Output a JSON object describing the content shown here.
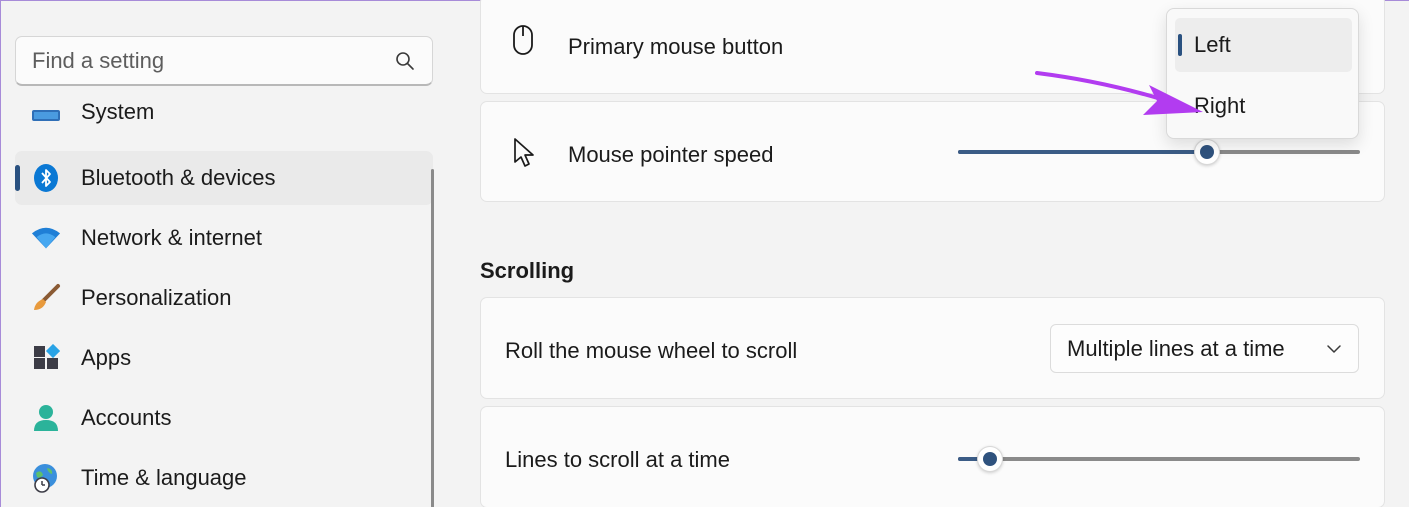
{
  "search": {
    "placeholder": "Find a setting",
    "icon": "search-icon"
  },
  "sidebar": {
    "items": [
      {
        "label": "System",
        "icon": "monitor-icon",
        "active": false
      },
      {
        "label": "Bluetooth & devices",
        "icon": "bluetooth-icon",
        "active": true
      },
      {
        "label": "Network & internet",
        "icon": "wifi-icon",
        "active": false
      },
      {
        "label": "Personalization",
        "icon": "paintbrush-icon",
        "active": false
      },
      {
        "label": "Apps",
        "icon": "apps-icon",
        "active": false
      },
      {
        "label": "Accounts",
        "icon": "person-icon",
        "active": false
      },
      {
        "label": "Time & language",
        "icon": "globe-clock-icon",
        "active": false
      }
    ]
  },
  "mouse": {
    "primary_button": {
      "label": "Primary mouse button",
      "icon": "mouse-icon"
    },
    "pointer_speed": {
      "label": "Mouse pointer speed",
      "icon": "cursor-icon",
      "value_fraction": 0.62
    }
  },
  "primary_button_menu": {
    "options": [
      {
        "label": "Left",
        "selected": true
      },
      {
        "label": "Right",
        "selected": false
      }
    ]
  },
  "scrolling": {
    "title": "Scrolling",
    "wheel": {
      "label": "Roll the mouse wheel to scroll",
      "value": "Multiple lines at a time"
    },
    "lines": {
      "label": "Lines to scroll at a time",
      "value_fraction": 0.08
    }
  },
  "colors": {
    "accent": "#2a5180",
    "annotation_arrow": "#b23cf0"
  }
}
